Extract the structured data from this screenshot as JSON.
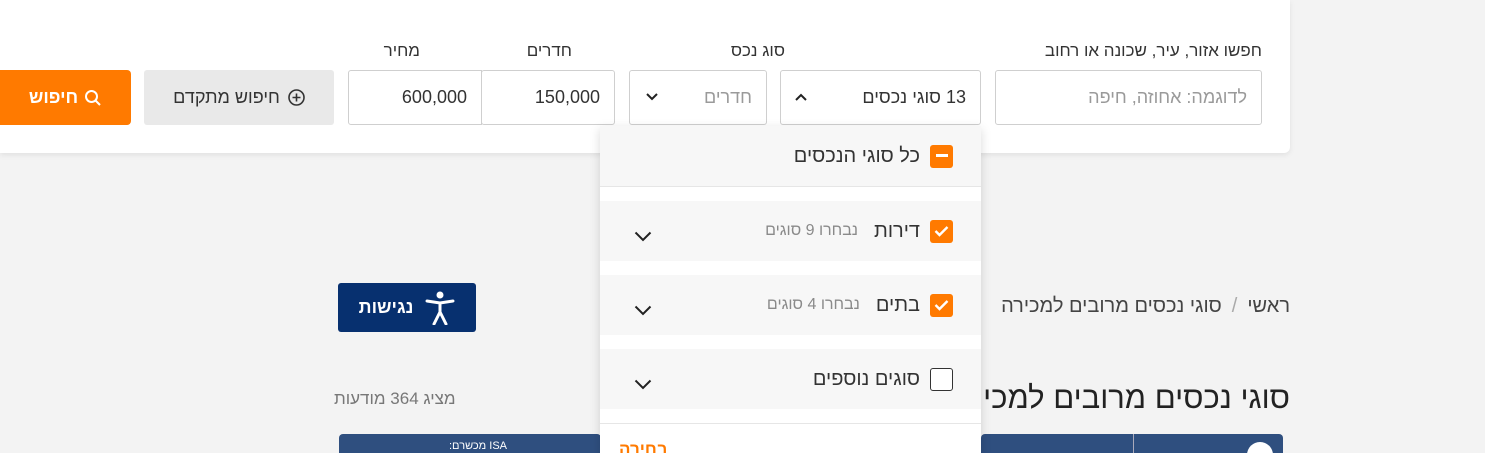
{
  "search": {
    "location_label": "חפשו אזור, עיר, שכונה או רחוב",
    "location_placeholder": "לדוגמה: אחוזה, חיפה",
    "type_label": "סוג נכס",
    "type_value": "13 סוגי נכסים",
    "rooms_label": "חדרים",
    "rooms_placeholder": "חדרים",
    "price_label": "מחיר",
    "price_min": "150,000",
    "price_max": "600,000",
    "advanced_label": "חיפוש מתקדם",
    "search_label": "חיפוש"
  },
  "dropdown": {
    "all_label": "כל סוגי הנכסים",
    "groups": [
      {
        "label": "דירות",
        "sub": "נבחרו 9 סוגים",
        "checked": true
      },
      {
        "label": "בתים",
        "sub": "נבחרו 4 סוגים",
        "checked": true
      },
      {
        "label": "סוגים נוספים",
        "sub": "",
        "checked": false
      }
    ],
    "reset_label": "בחירה"
  },
  "breadcrumb": {
    "home": "ראשי",
    "separator": "/",
    "current": "סוגי נכסים מרובים למכירה"
  },
  "page": {
    "title": "סוגי נכסים מרובים למכירה",
    "count": "מציג 364 מודעות"
  },
  "accessibility": {
    "label": "נגישות"
  },
  "cards": {
    "caption": "ISA מכשרם:"
  },
  "colors": {
    "accent": "#ff7a00",
    "navy": "#07306f"
  }
}
